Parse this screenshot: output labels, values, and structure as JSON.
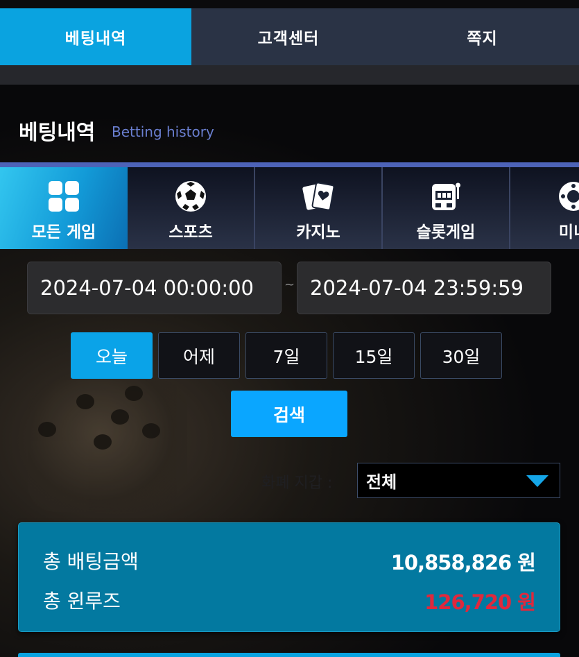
{
  "top_tabs": [
    {
      "label": "베팅내역",
      "active": true
    },
    {
      "label": "고객센터",
      "active": false
    },
    {
      "label": "쪽지",
      "active": false
    }
  ],
  "page": {
    "title": "베팅내역",
    "subtitle": "Betting history"
  },
  "game_tabs": [
    {
      "label": "모든 게임",
      "icon": "grid-icon",
      "active": true
    },
    {
      "label": "스포츠",
      "icon": "soccer-ball-icon",
      "active": false
    },
    {
      "label": "카지노",
      "icon": "playing-cards-icon",
      "active": false
    },
    {
      "label": "슬롯게임",
      "icon": "slot-machine-icon",
      "active": false
    },
    {
      "label": "미니",
      "icon": "mini-game-icon",
      "active": false
    }
  ],
  "date_range": {
    "from": "2024-07-04 00:00:00",
    "separator": "~",
    "to": "2024-07-04 23:59:59"
  },
  "quick_ranges": [
    {
      "label": "오늘",
      "active": true
    },
    {
      "label": "어제",
      "active": false
    },
    {
      "label": "7일",
      "active": false
    },
    {
      "label": "15일",
      "active": false
    },
    {
      "label": "30일",
      "active": false
    }
  ],
  "search_label": "검색",
  "currency": {
    "label": "화폐 지갑 :",
    "selected": "전체"
  },
  "summary": {
    "total_bet_label": "총 배팅금액",
    "total_bet_value": "10,858,826 원",
    "total_win_label": "총 윈루즈",
    "total_win_value": "126,720 원"
  },
  "colors": {
    "accent": "#0aa3e0",
    "win_value": "#e0283c",
    "summary_bg": "#0379a0"
  }
}
